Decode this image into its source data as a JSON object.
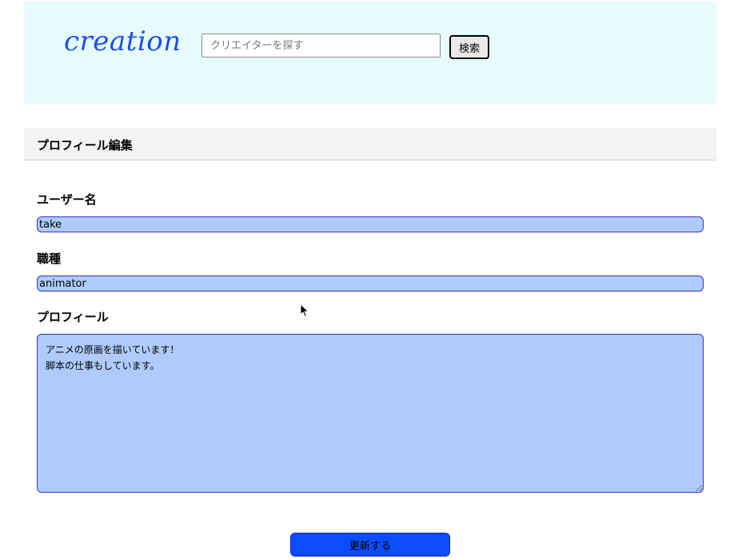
{
  "header": {
    "logo": "creation",
    "search": {
      "placeholder": "クリエイターを探す",
      "value": "",
      "button_label": "検索"
    }
  },
  "section": {
    "title": "プロフィール編集"
  },
  "form": {
    "username": {
      "label": "ユーザー名",
      "value": "take"
    },
    "job": {
      "label": "職種",
      "value": "animator"
    },
    "profile": {
      "label": "プロフィール",
      "value": "アニメの原画を描いています！\n脚本の仕事もしています。"
    },
    "submit_label": "更新する"
  },
  "colors": {
    "header_bg": "#e6fcfd",
    "logo": "#1f4fe6",
    "field_bg": "#aecbfc",
    "field_border": "#3a2fd0",
    "submit_bg": "#0a4dff"
  }
}
